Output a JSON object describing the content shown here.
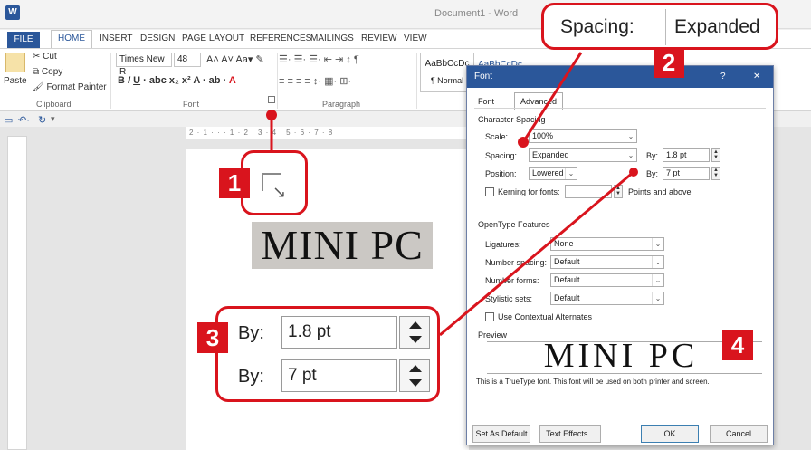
{
  "titlebar": {
    "app_icon": "W",
    "doc_title": "Document1 - Word"
  },
  "tabs": [
    "FILE",
    "HOME",
    "INSERT",
    "DESIGN",
    "PAGE LAYOUT",
    "REFERENCES",
    "MAILINGS",
    "REVIEW",
    "VIEW"
  ],
  "ribbon": {
    "paste": "Paste",
    "cut": "Cut",
    "copy": "Copy",
    "format_painter": "Format Painter",
    "clipboard_group": "Clipboard",
    "font_name": "Times New R",
    "font_size": "48",
    "font_group": "Font",
    "paragraph_group": "Paragraph",
    "style_sample": "AaBbCcDc",
    "style_normal": "¶ Normal",
    "style_next": "AaBbCcDc"
  },
  "ruler_text": "2 · 1 · · · 1 · 2 · 3 · 4 · 5 · 6 · 7 · 8",
  "document": {
    "text": "MINI PC"
  },
  "dialog": {
    "title": "Font",
    "help": "?",
    "close": "✕",
    "tab_font": "Font",
    "tab_advanced": "Advanced",
    "char_spacing_header": "Character Spacing",
    "scale_label": "Scale:",
    "scale_value": "100%",
    "spacing_label": "Spacing:",
    "spacing_value": "Expanded",
    "by1_label": "By:",
    "by1_value": "1.8 pt",
    "position_label": "Position:",
    "position_value": "Lowered",
    "by2_label": "By:",
    "by2_value": "7 pt",
    "kerning_label": "Kerning for fonts:",
    "kerning_suffix": "Points and above",
    "opentype_header": "OpenType Features",
    "ligatures_label": "Ligatures:",
    "ligatures_value": "None",
    "numspacing_label": "Number spacing:",
    "numspacing_value": "Default",
    "numforms_label": "Number forms:",
    "numforms_value": "Default",
    "stylistic_label": "Stylistic sets:",
    "stylistic_value": "Default",
    "contextual_label": "Use Contextual Alternates",
    "preview_header": "Preview",
    "preview_text": "MINI PC",
    "truetype_note": "This is a TrueType font. This font will be used on both printer and screen.",
    "set_default": "Set As Default",
    "text_effects": "Text Effects...",
    "ok": "OK",
    "cancel": "Cancel"
  },
  "callouts": {
    "badge1": "1",
    "badge2": "2",
    "badge3": "3",
    "badge4": "4",
    "spacing_label": "Spacing:",
    "spacing_value": "Expanded",
    "by1_label": "By:",
    "by1_value": "1.8 pt",
    "by2_label": "By:",
    "by2_value": "7 pt"
  },
  "colors": {
    "accent": "#d9141d",
    "word_blue": "#2b579a"
  }
}
